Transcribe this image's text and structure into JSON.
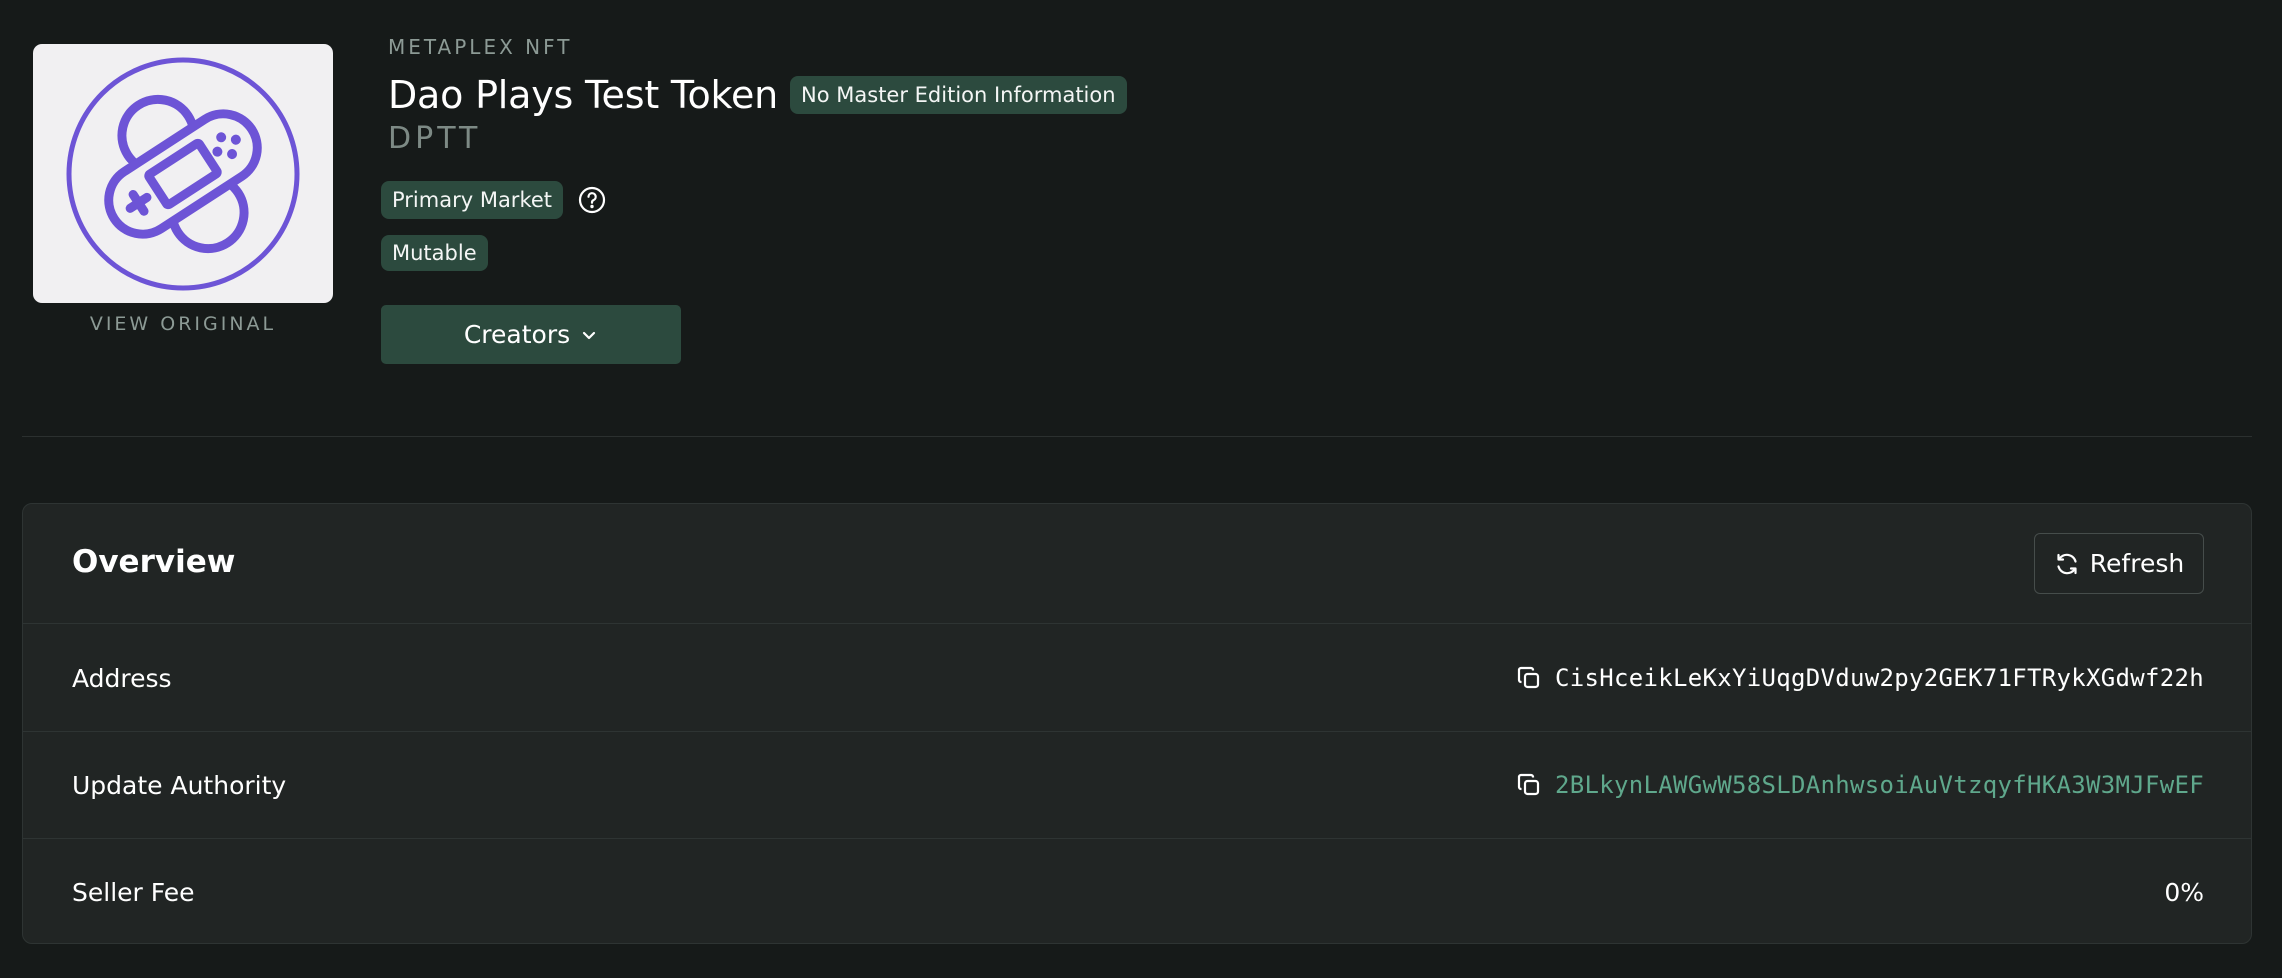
{
  "header": {
    "eyebrow": "METAPLEX NFT",
    "title": "Dao Plays Test Token",
    "edition_badge": "No Master Edition Information",
    "symbol": "DPTT",
    "market_badge": "Primary Market",
    "mutable_badge": "Mutable",
    "view_original": "VIEW ORIGINAL",
    "creators_label": "Creators"
  },
  "overview": {
    "title": "Overview",
    "refresh_label": "Refresh",
    "rows": [
      {
        "label": "Address",
        "value": "CisHceikLeKxYiUqgDVduw2py2GEK71FTRykXGdwf22h"
      },
      {
        "label": "Update Authority",
        "value": "2BLkynLAWGwW58SLDAnhwsoiAuVtzqyfHKA3W3MJFwEF"
      },
      {
        "label": "Seller Fee",
        "value": "0%"
      }
    ]
  },
  "colors": {
    "background": "#161a19",
    "card": "#212524",
    "badge": "#2c4a3e",
    "link": "#5fa88c",
    "logo": "#6d54d6"
  },
  "icons": [
    "gamepad-logo-icon",
    "help-circle-icon",
    "chevron-down-icon",
    "refresh-icon",
    "copy-icon"
  ]
}
